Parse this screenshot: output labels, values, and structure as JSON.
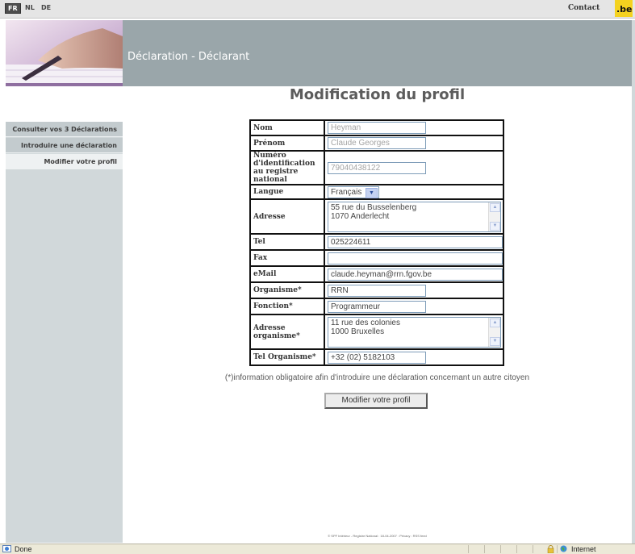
{
  "topbar": {
    "languages": [
      "FR",
      "NL",
      "DE"
    ],
    "active_language": "FR",
    "contact": "Contact",
    "logo_text": ".be"
  },
  "sidebar": {
    "items": [
      {
        "label": "Consulter vos 3 Déclarations"
      },
      {
        "label": "Introduire une déclaration"
      },
      {
        "label": "Modifier votre profil",
        "selected": true
      }
    ]
  },
  "header": {
    "title": "Déclaration - Déclarant"
  },
  "main": {
    "title": "Modification du profil",
    "form": {
      "nom": {
        "label": "Nom",
        "value": "Heyman"
      },
      "prenom": {
        "label": "Prénom",
        "value": "Claude Georges"
      },
      "numero": {
        "label": "Numéro d'identification au registre national",
        "value": "79040438122"
      },
      "langue": {
        "label": "Langue",
        "value": "Français"
      },
      "adresse": {
        "label": "Adresse",
        "line1": "55 rue du Busselenberg",
        "line2": "1070 Anderlecht"
      },
      "tel": {
        "label": "Tel",
        "value": "025224611"
      },
      "fax": {
        "label": "Fax",
        "value": ""
      },
      "email": {
        "label": "eMail",
        "value": "claude.heyman@rrn.fgov.be"
      },
      "organisme": {
        "label": "Organisme*",
        "value": "RRN"
      },
      "fonction": {
        "label": "Fonction*",
        "value": "Programmeur"
      },
      "adresse_org": {
        "label": "Adresse organisme*",
        "line1": "11 rue des colonies",
        "line2": "1000 Bruxelles"
      },
      "tel_org": {
        "label": "Tel Organisme*",
        "value": "+32 (02) 5182103"
      }
    },
    "note": "(*)information obligatoire afin d'introduire une déclaration concernant un autre citoyen",
    "submit": "Modifier votre profil"
  },
  "footer": {
    "text": "© SPF Intérieur - Registre National : 18-04-2007 : Privacy : RSS feed"
  },
  "statusbar": {
    "status": "Done",
    "zone": "Internet"
  },
  "colors": {
    "header_bg": "#9aa6aa",
    "sidebar_bg": "#d1d8da",
    "title_color": "#5c5c5c"
  }
}
